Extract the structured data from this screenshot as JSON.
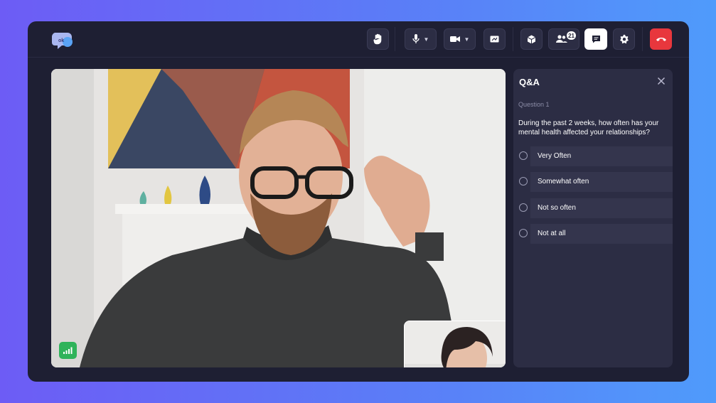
{
  "toolbar": {
    "raise_hand": "raise-hand",
    "mic": "microphone",
    "camera": "camera",
    "share": "screen-share",
    "apps": "apps",
    "participants_count": "21",
    "chat": "chat",
    "settings": "settings",
    "end_call": "end-call"
  },
  "qa": {
    "title": "Q&A",
    "question_number": "Question 1",
    "question_text": "During the past 2 weeks, how often has your mental health affected your relationships?",
    "options": [
      {
        "label": "Very Often"
      },
      {
        "label": "Somewhat often"
      },
      {
        "label": "Not so often"
      },
      {
        "label": "Not at all"
      }
    ]
  },
  "colors": {
    "background_start": "#6d5cf5",
    "background_end": "#4f9bfb",
    "app_bg": "#1e1f33",
    "panel_bg": "#2c2d44",
    "end_call": "#e8373d",
    "signal_green": "#2fb35a"
  }
}
